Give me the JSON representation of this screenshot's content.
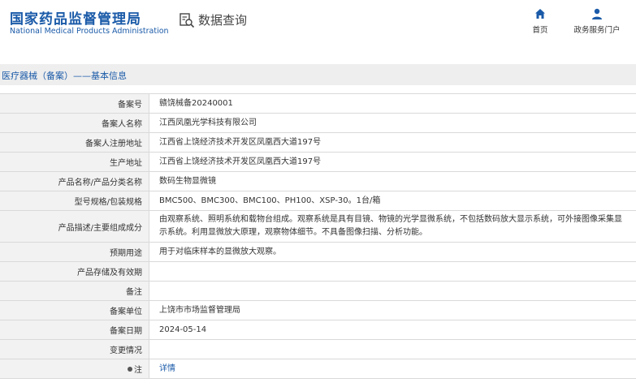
{
  "header": {
    "logo_cn": "国家药品监督管理局",
    "logo_en": "National Medical Products Administration",
    "query_label": "数据查询",
    "nav": [
      {
        "label": "首页",
        "icon": "home-icon"
      },
      {
        "label": "政务服务门户",
        "icon": "user-icon"
      }
    ]
  },
  "title": "医疗器械（备案）——基本信息",
  "rows": [
    {
      "label": "备案号",
      "value": "赣饶械备20240001"
    },
    {
      "label": "备案人名称",
      "value": "江西凤凰光学科技有限公司"
    },
    {
      "label": "备案人注册地址",
      "value": "江西省上饶经济技术开发区凤凰西大道197号"
    },
    {
      "label": "生产地址",
      "value": "江西省上饶经济技术开发区凤凰西大道197号"
    },
    {
      "label": "产品名称/产品分类名称",
      "value": "数码生物显微镜"
    },
    {
      "label": "型号规格/包装规格",
      "value": "BMC500、BMC300、BMC100、PH100、XSP-30。1台/箱"
    },
    {
      "label": "产品描述/主要组成成分",
      "value": "由观察系统、照明系统和载物台组成。观察系统是具有目镜、物镜的光学显微系统，不包括数码放大显示系统，可外接图像采集显示系统。利用显微放大原理，观察物体细节。不具备图像扫描、分析功能。"
    },
    {
      "label": "预期用途",
      "value": "用于对临床样本的显微放大观察。"
    },
    {
      "label": "产品存储及有效期",
      "value": ""
    },
    {
      "label": "备注",
      "value": ""
    },
    {
      "label": "备案单位",
      "value": "上饶市市场监督管理局"
    },
    {
      "label": "备案日期",
      "value": "2024-05-14"
    },
    {
      "label": "变更情况",
      "value": ""
    },
    {
      "label": "注",
      "value": "详情"
    }
  ],
  "colors": {
    "brand": "#1a5aa8",
    "label_bg": "#f2f2f2",
    "band_bg": "#eeeeee"
  }
}
